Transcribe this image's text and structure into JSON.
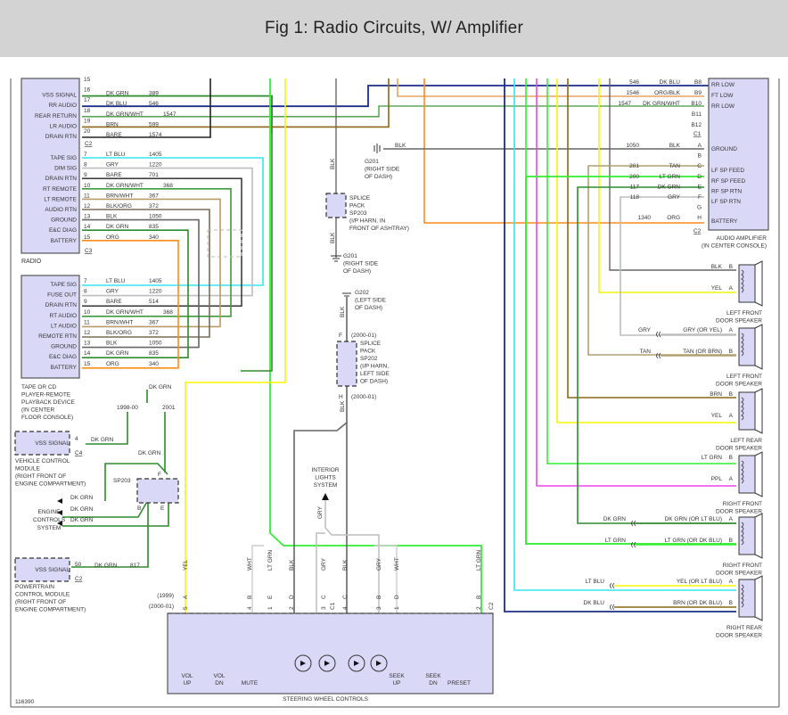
{
  "title": "Fig 1: Radio Circuits, W/ Amplifier",
  "figure_id": "116390",
  "colors": {
    "DK GRN": "#2e8b2e",
    "DK BLU": "#1a2f8a",
    "DK GRN/WHT": "#3c9a3c",
    "BRN": "#8b6914",
    "BARE": "#222222",
    "LT BLU": "#33e6f0",
    "GRY": "#bdbdbd",
    "BRN/WHT": "#b89968",
    "BLK/ORG": "#7a6a55",
    "BLK": "#666666",
    "ORG": "#ff8c1a",
    "ORG/BLK": "#e8a060",
    "YEL": "#f5f500",
    "LT GRN": "#33ee33",
    "TAN": "#b0a070",
    "PPL": "#ee44ee",
    "WHT": "#cccccc",
    "box_fill": "#d9d9f7"
  },
  "radio": {
    "label": "RADIO",
    "c2_label": "C2",
    "c3_label": "C3",
    "c2_pins": [
      {
        "pin": "15",
        "name": "",
        "color": "",
        "circuit": ""
      },
      {
        "pin": "16",
        "name": "VSS SIGNAL",
        "color": "DK GRN",
        "circuit": "389"
      },
      {
        "pin": "17",
        "name": "RR AUDIO",
        "color": "DK BLU",
        "circuit": "546"
      },
      {
        "pin": "18",
        "name": "REAR RETURN",
        "color": "DK GRN/WHT",
        "circuit": "1547"
      },
      {
        "pin": "19",
        "name": "LR AUDIO",
        "color": "BRN",
        "circuit": "599"
      },
      {
        "pin": "20",
        "name": "DRAIN RTN",
        "color": "BARE",
        "circuit": "1574"
      }
    ],
    "c3_pins": [
      {
        "pin": "7",
        "name": "TAPE SIG",
        "color": "LT BLU",
        "circuit": "1405"
      },
      {
        "pin": "8",
        "name": "DIM SIG",
        "color": "GRY",
        "circuit": "1220"
      },
      {
        "pin": "9",
        "name": "DRAIN RTN",
        "color": "BARE",
        "circuit": "701"
      },
      {
        "pin": "10",
        "name": "RT REMOTE",
        "color": "DK GRN/WHT",
        "circuit": "368"
      },
      {
        "pin": "11",
        "name": "LT REMOTE",
        "color": "BRN/WHT",
        "circuit": "367"
      },
      {
        "pin": "12",
        "name": "AUDIO RTN",
        "color": "BLK/ORG",
        "circuit": "372"
      },
      {
        "pin": "13",
        "name": "GROUND",
        "color": "BLK",
        "circuit": "1050"
      },
      {
        "pin": "14",
        "name": "E&C DIAG",
        "color": "DK GRN",
        "circuit": "835"
      },
      {
        "pin": "15",
        "name": "BATTERY",
        "color": "ORG",
        "circuit": "340"
      }
    ]
  },
  "tape_player": {
    "label_lines": [
      "TAPE OR CD",
      "PLAYER-REMOTE",
      "PLAYBACK DEVICE",
      "(IN CENTER",
      "FLOOR CONSOLE)"
    ],
    "pins": [
      {
        "pin": "7",
        "name": "TAPE SIG",
        "color": "LT BLU",
        "circuit": "1405"
      },
      {
        "pin": "8",
        "name": "FUSE OUT",
        "color": "GRY",
        "circuit": "1220"
      },
      {
        "pin": "9",
        "name": "DRAIN RTN",
        "color": "BARE",
        "circuit": "514"
      },
      {
        "pin": "10",
        "name": "RT AUDIO",
        "color": "DK GRN/WHT",
        "circuit": "368"
      },
      {
        "pin": "11",
        "name": "LT AUDIO",
        "color": "BRN/WHT",
        "circuit": "367"
      },
      {
        "pin": "12",
        "name": "REMOTE RTN",
        "color": "BLK/ORG",
        "circuit": "372"
      },
      {
        "pin": "13",
        "name": "GROUND",
        "color": "BLK",
        "circuit": "1050"
      },
      {
        "pin": "14",
        "name": "E&C DIAG",
        "color": "DK GRN",
        "circuit": "835"
      },
      {
        "pin": "15",
        "name": "BATTERY",
        "color": "ORG",
        "circuit": "340"
      }
    ]
  },
  "vss_branch": {
    "wire_label": "DK GRN",
    "year_left": "1998-00",
    "year_right": "2001",
    "sp_wire_label": "DK GRN"
  },
  "vcm": {
    "signal": "VSS SIGNAL",
    "pin": "4",
    "wire": "DK GRN",
    "connector": "C4",
    "label_lines": [
      "VEHICLE CONTROL",
      "MODULE",
      "(RIGHT FRONT OF",
      "ENGINE COMPARTMENT)"
    ]
  },
  "sp203_engine": {
    "label": "SP203",
    "pin_f": "F",
    "pin_b": "B",
    "pin_e": "E"
  },
  "engine_controls": {
    "label_lines": [
      "ENGINE",
      "CONTROLS",
      "SYSTEM"
    ],
    "wires": [
      "DK GRN",
      "DK GRN",
      "DK GRN"
    ]
  },
  "pcm": {
    "signal": "VSS SIGNAL",
    "pin": "50",
    "wire": "DK GRN",
    "circuit": "817",
    "connector": "C2",
    "label_lines": [
      "POWERTRAIN",
      "CONTROL MODULE",
      "(RIGHT FRONT OF",
      "ENGINE COMPARTMENT)"
    ]
  },
  "grounds": {
    "g201_top": {
      "wire": "BLK",
      "label_lines": [
        "G201",
        "(RIGHT SIDE",
        "OF DASH)"
      ]
    },
    "g201_bottom": {
      "label_lines": [
        "G201",
        "(RIGHT SIDE",
        "OF DASH)"
      ]
    },
    "g202": {
      "label_lines": [
        "G202",
        "(LEFT SIDE",
        "OF DASH)"
      ]
    },
    "sp203_pack": {
      "wire_top": "BLK",
      "wire_bottom": "BLK",
      "label_lines": [
        "SPLICE",
        "PACK",
        "SP203",
        "(I/P HARN, IN",
        "FRONT OF ASHTRAY)"
      ]
    },
    "sp202_pack": {
      "wire_top": "BLK",
      "wire_bottom": "BLK",
      "pin_top": "F",
      "pin_bottom": "H",
      "year_top": "(2000-01)",
      "year_bottom": "(2000-01)",
      "label_lines": [
        "SPLICE",
        "PACK",
        "SP202",
        "(I/P HARN,",
        "LEFT SIDE",
        "OF DASH)"
      ]
    }
  },
  "interior_lights": {
    "label_lines": [
      "INTERIOR",
      "LIGHTS",
      "SYSTEM"
    ],
    "wire": "GRY"
  },
  "amplifier": {
    "label_lines": [
      "AUDIO AMPLIFIER",
      "(IN CENTER CONSOLE)"
    ],
    "c1_label": "C1",
    "c2_label": "C2",
    "c1_pins": [
      {
        "pin": "B8",
        "name": "RR LOW",
        "color": "DK BLU",
        "circuit": "546"
      },
      {
        "pin": "B9",
        "name": "FT LOW",
        "color": "ORG/BLK",
        "circuit": "1546"
      },
      {
        "pin": "B10",
        "name": "RR LOW",
        "color": "DK GRN/WHT",
        "circuit": "1547"
      },
      {
        "pin": "B11",
        "name": "",
        "color": "",
        "circuit": ""
      },
      {
        "pin": "B12",
        "name": "",
        "color": "",
        "circuit": ""
      }
    ],
    "c2_pins": [
      {
        "pin": "A",
        "name": "GROUND",
        "color": "BLK",
        "circuit": "1050"
      },
      {
        "pin": "B",
        "name": "",
        "color": "",
        "circuit": ""
      },
      {
        "pin": "C",
        "name": "LF SP FEED",
        "color": "TAN",
        "circuit": "201"
      },
      {
        "pin": "D",
        "name": "RF SP FEED",
        "color": "LT GRN",
        "circuit": "200"
      },
      {
        "pin": "E",
        "name": "RF SP RTN",
        "color": "DK GRN",
        "circuit": "117"
      },
      {
        "pin": "F",
        "name": "LF SP RTN",
        "color": "GRY",
        "circuit": "118"
      },
      {
        "pin": "G",
        "name": "",
        "color": "",
        "circuit": ""
      },
      {
        "pin": "H",
        "name": "BATTERY",
        "color": "ORG",
        "circuit": "1340"
      }
    ]
  },
  "speakers": [
    {
      "label_lines": [
        "LEFT FRONT",
        "DOOR SPEAKER"
      ],
      "wires": [
        {
          "pin": "B",
          "left": "",
          "right": "BLK",
          "color": "BLK",
          "right_color": "BLK"
        },
        {
          "pin": "A",
          "left": "",
          "right": "YEL",
          "color": "YEL",
          "right_color": "YEL"
        }
      ]
    },
    {
      "label_lines": [
        "LEFT FRONT",
        "DOOR SPEAKER"
      ],
      "wires": [
        {
          "pin": "A",
          "left": "GRY",
          "right": "GRY (OR YEL)",
          "color": "GRY",
          "right_color": "GRY"
        },
        {
          "pin": "B",
          "left": "TAN",
          "right": "TAN (OR BRN)",
          "color": "TAN",
          "right_color": "TAN"
        }
      ]
    },
    {
      "label_lines": [
        "LEFT REAR",
        "DOOR SPEAKER"
      ],
      "wires": [
        {
          "pin": "B",
          "left": "",
          "right": "BRN",
          "color": "BRN",
          "right_color": "BRN"
        },
        {
          "pin": "A",
          "left": "",
          "right": "YEL",
          "color": "YEL",
          "right_color": "YEL"
        }
      ]
    },
    {
      "label_lines": [
        "RIGHT FRONT",
        "DOOR SPEAKER"
      ],
      "wires": [
        {
          "pin": "B",
          "left": "",
          "right": "LT GRN",
          "color": "LT GRN",
          "right_color": "LT GRN"
        },
        {
          "pin": "A",
          "left": "",
          "right": "PPL",
          "color": "PPL",
          "right_color": "PPL"
        }
      ]
    },
    {
      "label_lines": [
        "RIGHT FRONT",
        "DOOR SPEAKER"
      ],
      "wires": [
        {
          "pin": "A",
          "left": "DK GRN",
          "right": "DK GRN (OR LT BLU)",
          "color": "DK GRN",
          "right_color": "DK GRN"
        },
        {
          "pin": "B",
          "left": "LT GRN",
          "right": "LT GRN (OR DK BLU)",
          "color": "LT GRN",
          "right_color": "LT GRN"
        }
      ]
    },
    {
      "label_lines": [
        "RIGHT REAR",
        "DOOR SPEAKER"
      ],
      "wires": [
        {
          "pin": "A",
          "left": "LT BLU",
          "right": "YEL (OR LT BLU)",
          "color": "LT BLU",
          "right_color": "YEL"
        },
        {
          "pin": "B",
          "left": "DK BLU",
          "right": "BRN (OR DK BLU)",
          "color": "DK BLU",
          "right_color": "BRN"
        }
      ]
    }
  ],
  "steering_wheel": {
    "label": "STEERING WHEEL CONTROLS",
    "year_1999": "(1999)",
    "year_2000": "(2000-01)",
    "c1_label": "C1",
    "c2_label": "C2",
    "pins": [
      {
        "wire": "YEL",
        "pin_1999": "A",
        "pin_2000": "5",
        "color": "YEL"
      },
      {
        "wire": "WHT",
        "pin_1999": "B",
        "pin_2000": "4",
        "color": "WHT"
      },
      {
        "wire": "LT GRN",
        "pin_1999": "E",
        "pin_2000": "1",
        "color": "LT GRN"
      },
      {
        "wire": "BLK",
        "pin_1999": "D",
        "pin_2000": "2",
        "color": "BLK"
      },
      {
        "wire": "GRY",
        "pin_1999": "C",
        "pin_2000": "3",
        "color": "GRY"
      },
      {
        "wire": "BLK",
        "pin_1999": "C",
        "pin_2000": "4",
        "color": "BLK"
      },
      {
        "wire": "GRY",
        "pin_1999": "B",
        "pin_2000": "3",
        "color": "GRY"
      },
      {
        "wire": "WHT",
        "pin_1999": "D",
        "pin_2000": "1",
        "color": "WHT"
      },
      {
        "wire": "LT GRN",
        "pin_1999": "B",
        "pin_2000": "2",
        "color": "LT GRN"
      }
    ],
    "switches": [
      "VOL UP",
      "VOL DN",
      "MUTE",
      "SEEK UP",
      "SEEK DN",
      "PRESET"
    ]
  }
}
